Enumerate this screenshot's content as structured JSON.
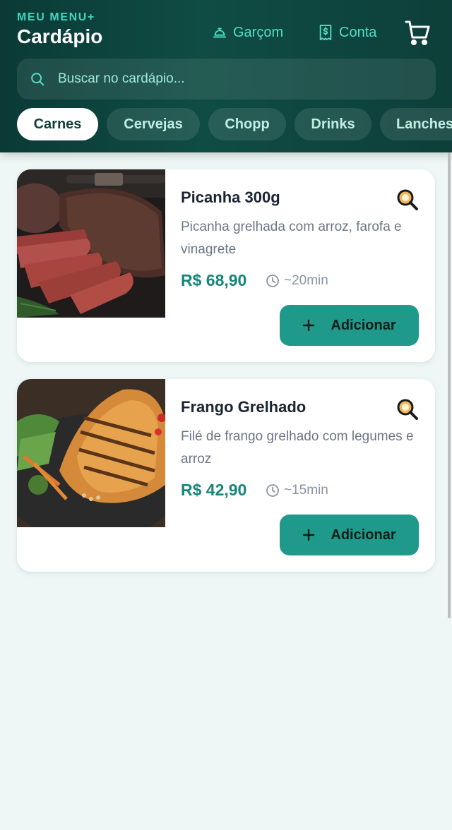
{
  "header": {
    "brand_sub": "MEU MENU+",
    "title": "Cardápio",
    "waiter_label": "Garçom",
    "bill_label": "Conta"
  },
  "search": {
    "placeholder": "Buscar no cardápio..."
  },
  "categories": [
    "Carnes",
    "Cervejas",
    "Chopp",
    "Drinks",
    "Lanches"
  ],
  "active_category": "Carnes",
  "items": [
    {
      "name": "Picanha 300g",
      "description": "Picanha grelhada com arroz, farofa e vinagrete",
      "price": "R$ 68,90",
      "time": "~20min",
      "add_label": "Adicionar"
    },
    {
      "name": "Frango Grelhado",
      "description": "Filé de frango grelhado com legumes e arroz",
      "price": "R$ 42,90",
      "time": "~15min",
      "add_label": "Adicionar"
    }
  ],
  "icons": {
    "waiter": "service-bell-icon",
    "bill": "receipt-icon",
    "cart": "cart-icon",
    "search": "search-icon",
    "zoom": "magnifier-icon",
    "clock": "clock-icon",
    "plus": "plus-icon"
  },
  "colors": {
    "header_bg": "#0f4c44",
    "accent": "#3fd6bd",
    "price": "#16857a",
    "button": "#1f9a8a",
    "page_bg": "#eef7f5"
  }
}
